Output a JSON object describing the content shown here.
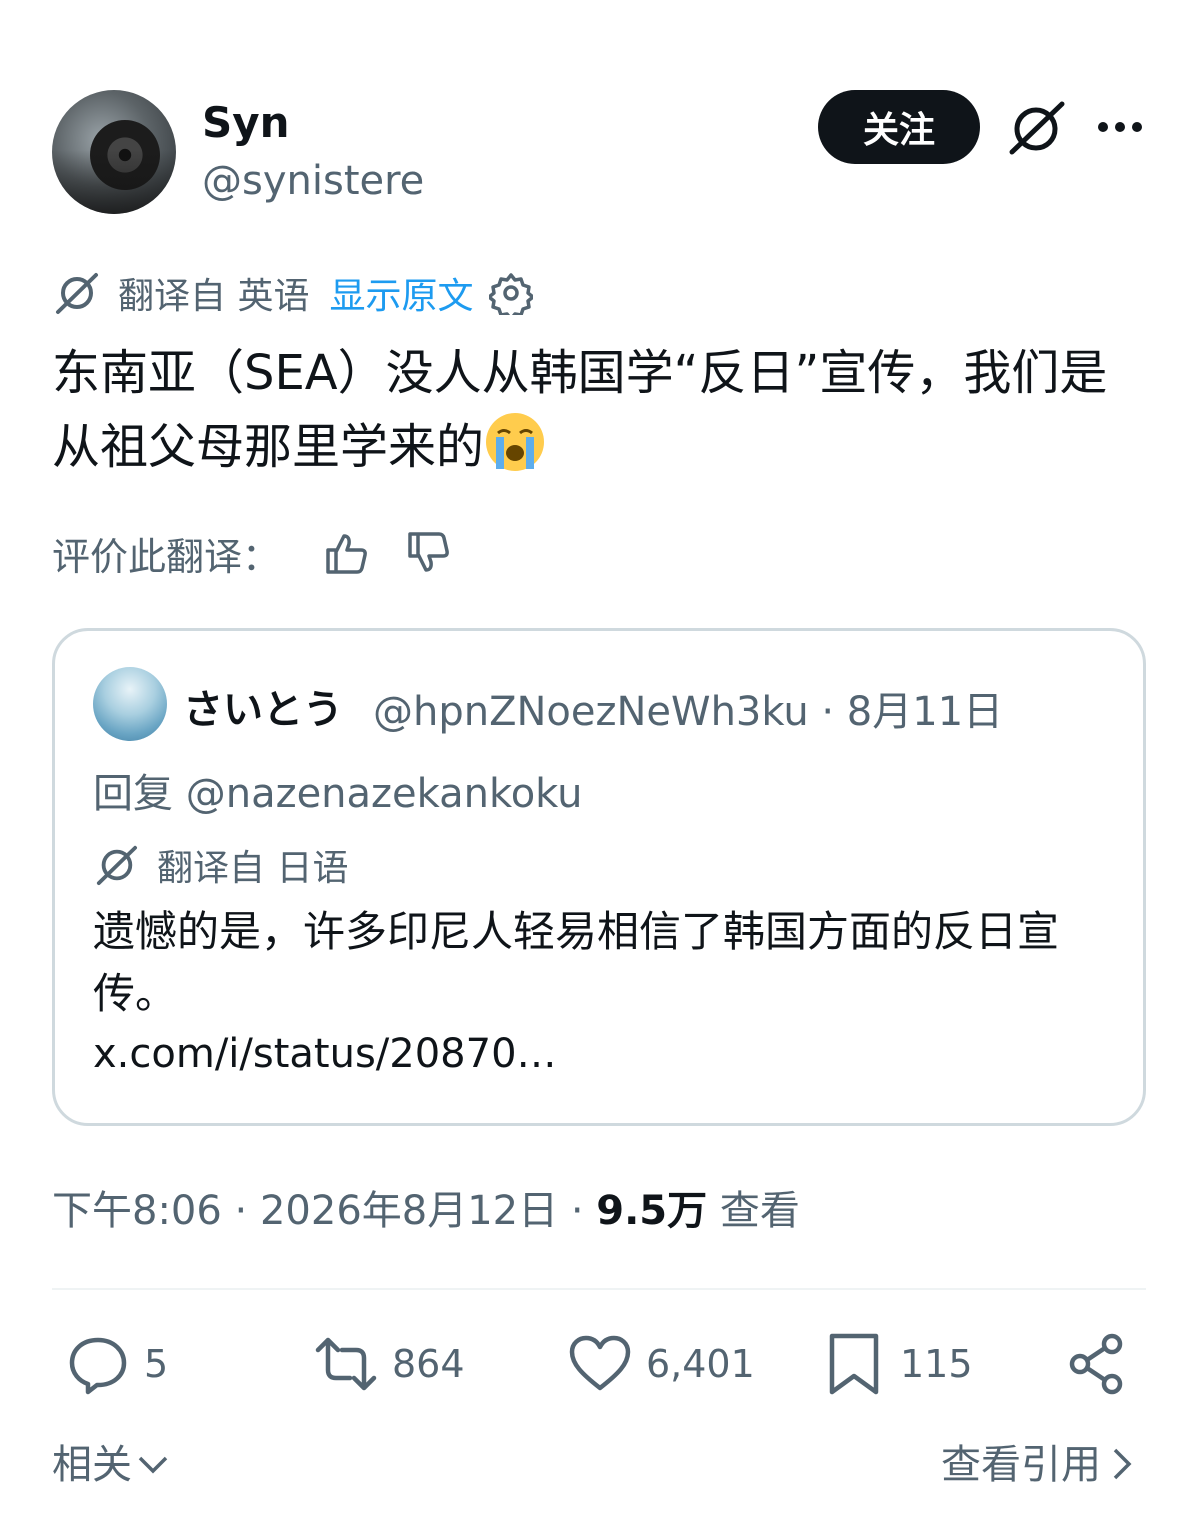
{
  "author": {
    "display_name": "Syn",
    "handle": "@synistere"
  },
  "header": {
    "follow_label": "关注"
  },
  "translation": {
    "translated_from": "翻译自 英语",
    "show_original": "显示原文"
  },
  "tweet": {
    "text": "东南亚（SEA）没人从韩国学“反日”宣传，我们是从祖父母那里学来的"
  },
  "rating": {
    "label": "评价此翻译："
  },
  "quote": {
    "name": "さいとう",
    "meta": "@hpnZNoezNeWh3ku · 8月11日",
    "reply_to": "回复 @nazenazekankoku",
    "translated_from": "翻译自 日语",
    "text": "遗憾的是，许多印尼人轻易相信了韩国方面的反日宣传。",
    "link": "x.com/i/status/20870…"
  },
  "timestamp": {
    "time": "下午8:06 · 2026年8月12日 · ",
    "views": "9.5万",
    "views_label": " 查看"
  },
  "actions": {
    "replies": "5",
    "retweets": "864",
    "likes": "6,401",
    "bookmarks": "115"
  },
  "footer": {
    "related": "相关",
    "view_quotes": "查看引用"
  },
  "colors": {
    "link_blue": "#1d9bf0",
    "secondary_text": "#536471",
    "primary_text": "#0f1419"
  }
}
